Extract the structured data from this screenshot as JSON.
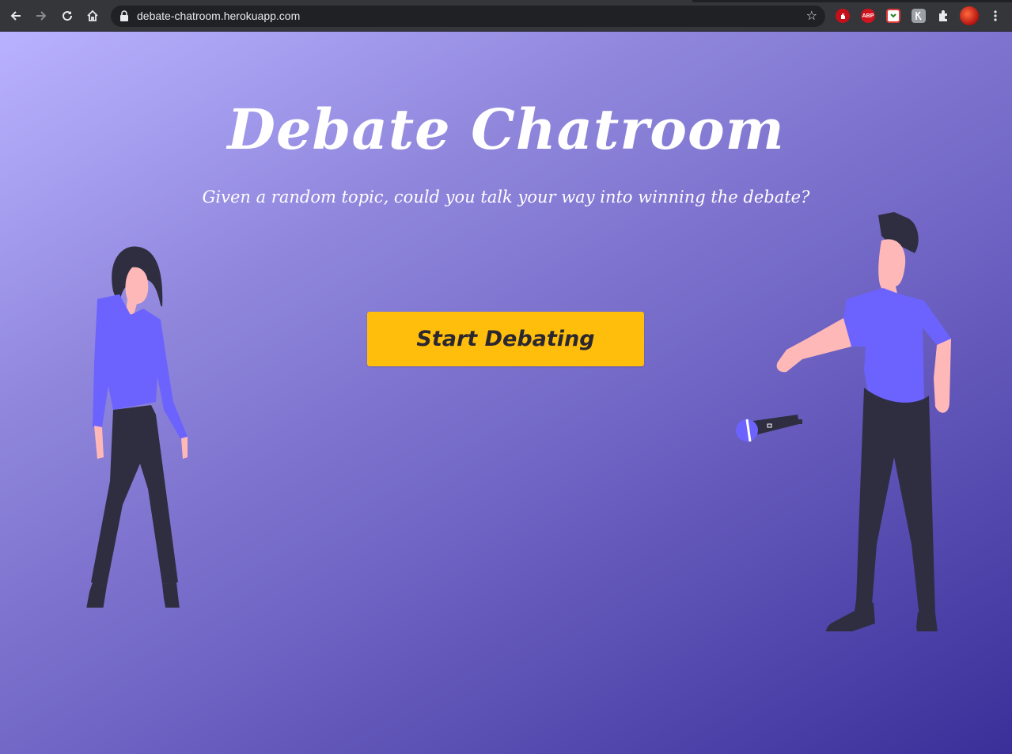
{
  "browser": {
    "url": "debate-chatroom.herokuapp.com",
    "extensions": [
      "adblock-icon",
      "abp-icon",
      "pocket-icon",
      "tab-manager-icon",
      "extensions-puzzle-icon",
      "profile-avatar"
    ],
    "abp_label": "ABP"
  },
  "page": {
    "title": "Debate Chatroom",
    "subtitle": "Given a random topic, could you talk your way into winning the debate?",
    "cta_label": "Start Debating"
  },
  "colors": {
    "button": "#ffbe0b",
    "shirt": "#6c63ff",
    "pants": "#2f2e41",
    "skin": "#ffb8b8"
  }
}
